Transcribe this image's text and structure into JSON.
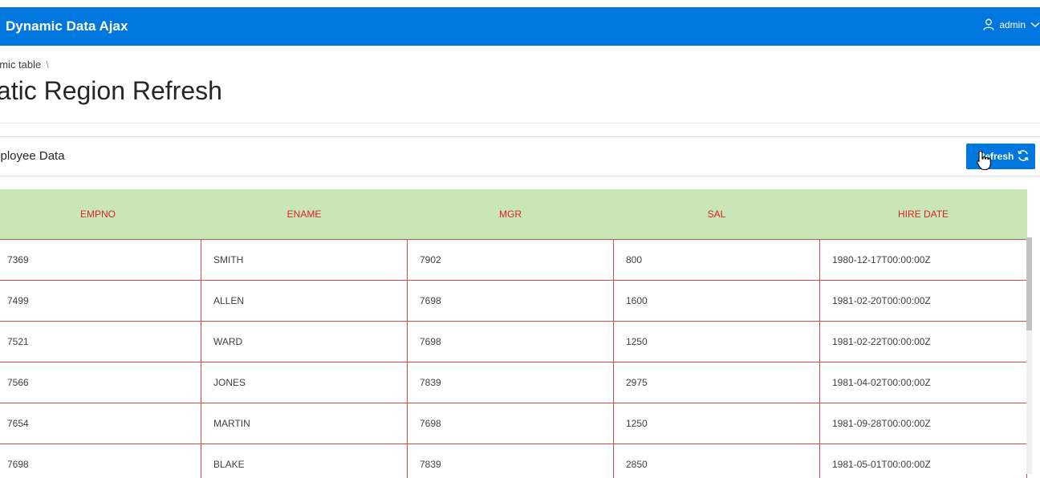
{
  "app": {
    "title": "Dynamic Data Ajax",
    "user": "admin"
  },
  "breadcrumb": {
    "item": "amic table",
    "separator": "\\"
  },
  "page": {
    "title": "tatic Region Refresh"
  },
  "region": {
    "title": "mployee Data",
    "refresh_label": "Refresh"
  },
  "table": {
    "headers": [
      "EMPNO",
      "ENAME",
      "MGR",
      "SAL",
      "HIRE DATE"
    ],
    "rows": [
      [
        "7369",
        "SMITH",
        "7902",
        "800",
        "1980-12-17T00:00:00Z"
      ],
      [
        "7499",
        "ALLEN",
        "7698",
        "1600",
        "1981-02-20T00:00:00Z"
      ],
      [
        "7521",
        "WARD",
        "7698",
        "1250",
        "1981-02-22T00:00:00Z"
      ],
      [
        "7566",
        "JONES",
        "7839",
        "2975",
        "1981-04-02T00:00:00Z"
      ],
      [
        "7654",
        "MARTIN",
        "7698",
        "1250",
        "1981-09-28T00:00:00Z"
      ],
      [
        "7698",
        "BLAKE",
        "7839",
        "2850",
        "1981-05-01T00:00:00Z"
      ]
    ]
  },
  "colors": {
    "brand": "#0076df",
    "header_bg": "#c9e7b6",
    "header_text": "#e02020",
    "row_border": "#d14b4b"
  },
  "icons": {
    "user": "user-icon",
    "chevron": "chevron-down-icon",
    "refresh": "refresh-icon",
    "cursor": "hand-cursor-icon"
  }
}
